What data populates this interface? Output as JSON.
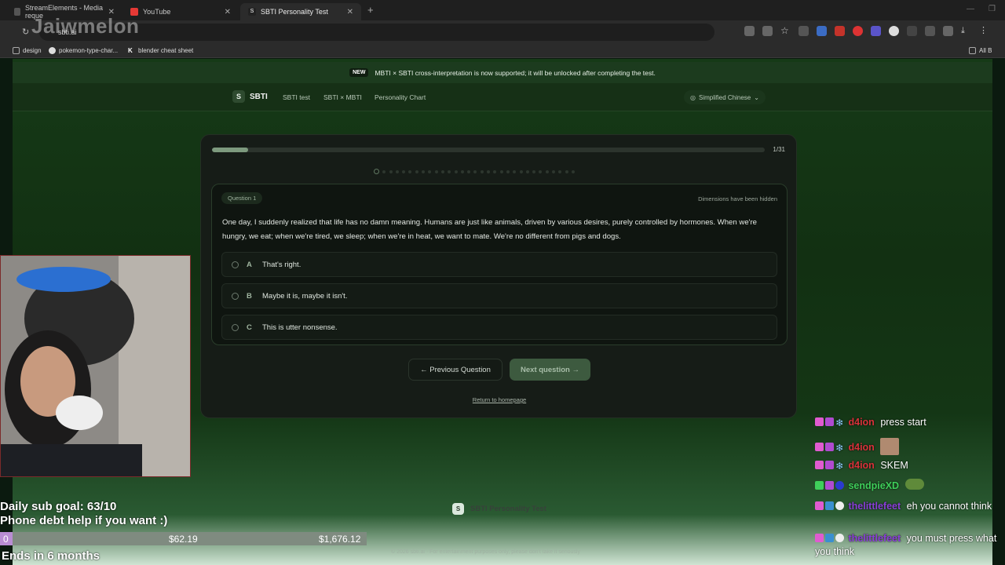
{
  "browser": {
    "tabs": [
      {
        "title": "StreamElements - Media reque"
      },
      {
        "title": "YouTube"
      },
      {
        "title": "SBTI Personality Test"
      }
    ],
    "url": "sbti.ai",
    "bookmarks": [
      {
        "label": "design"
      },
      {
        "label": "pokemon-type-char..."
      },
      {
        "label": "blender cheat sheet"
      },
      {
        "label": "All B"
      }
    ],
    "watermark": "Jaiwmelon"
  },
  "announcement": {
    "badge": "NEW",
    "text": "MBTI × SBTI cross-interpretation is now supported; it will be unlocked after completing the test."
  },
  "nav": {
    "logo": "S",
    "brand": "SBTI",
    "links": [
      "SBTI test",
      "SBTI × MBTI",
      "Personality Chart"
    ],
    "language": "Simplified Chinese"
  },
  "quiz": {
    "progress": 0.065,
    "count": "1/31",
    "total_dots": 31,
    "current_index": 1,
    "question_label": "Question 1",
    "hint": "Dimensions have been hidden",
    "question": "One day, I suddenly realized that life has no damn meaning. Humans are just like animals, driven by various desires, purely controlled by hormones. When we're hungry, we eat; when we're tired, we sleep; when we're in heat, we want to mate. We're no different from pigs and dogs.",
    "options": [
      {
        "key": "A",
        "text": "That's right."
      },
      {
        "key": "B",
        "text": "Maybe it is, maybe it isn't."
      },
      {
        "key": "C",
        "text": "This is utter nonsense."
      }
    ],
    "prev_label": "← Previous Question",
    "next_label": "Next question →",
    "home_link": "Return to homepage"
  },
  "footer": {
    "logo": "S",
    "title": "SBTI Personality Test",
    "copyright": "© 2026 sbti.ai · For entertainment purposes only, please don't take it seriously"
  },
  "stream": {
    "goal_line1": "Daily sub goal: 63/10",
    "goal_line2": "Phone debt help if you want :)",
    "bar_start": "0",
    "bar_mid": "$62.19",
    "bar_end": "$1,676.12",
    "ends": "Ends in 6 months",
    "chat": [
      {
        "user": "d4ion",
        "color": "#d8323a",
        "text": "press start"
      },
      {
        "user": "d4ion",
        "color": "#d8323a",
        "text": ""
      },
      {
        "user": "d4ion",
        "color": "#d8323a",
        "text": "SKEM"
      },
      {
        "user": "sendpieXD",
        "color": "#3fcf5a",
        "text": ""
      },
      {
        "user": "thelittlefeet",
        "color": "#8a3fd8",
        "text": "eh you cannot think"
      },
      {
        "user": "thelittlefeet",
        "color": "#8a3fd8",
        "text": "you must press what you think"
      }
    ]
  },
  "colors": {
    "accent": "#7d9a7e",
    "page_bg": "#143615",
    "card_bg": "#161c17"
  }
}
